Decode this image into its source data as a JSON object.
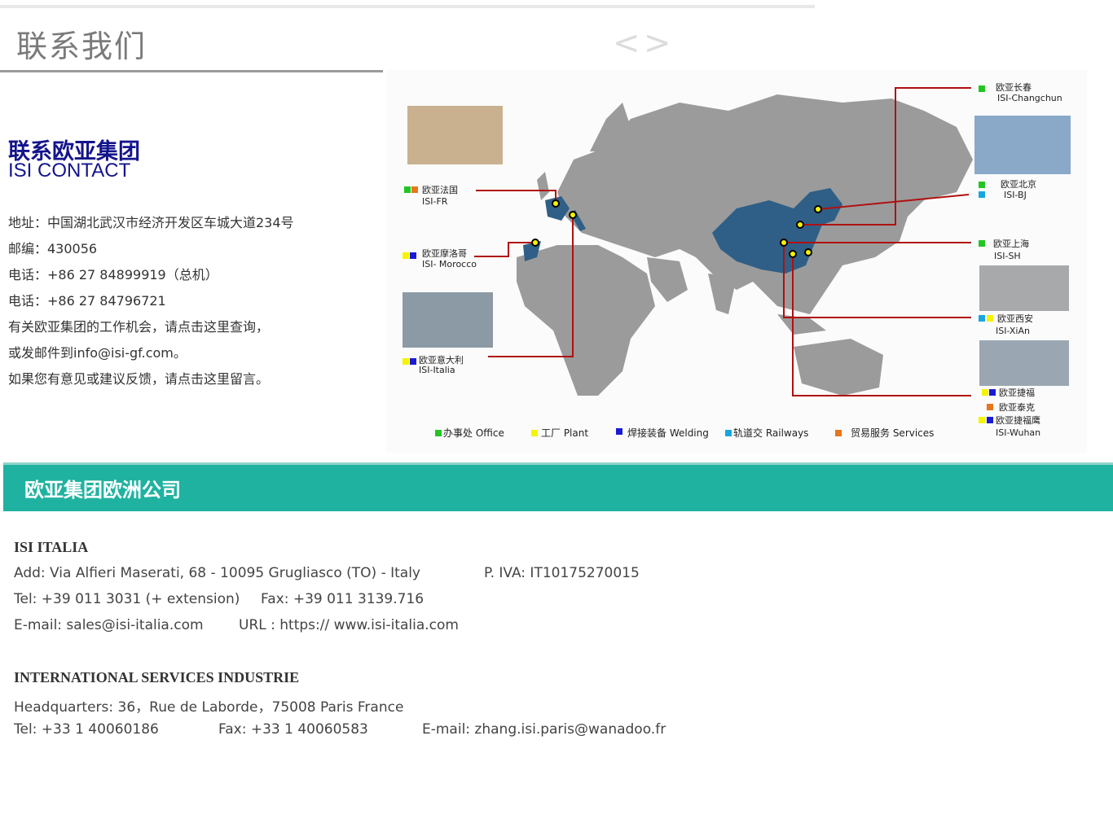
{
  "header": {
    "title": "联系我们",
    "prev_icon": "chevron-left-icon",
    "next_icon": "chevron-right-icon",
    "prev": "<",
    "next": ">"
  },
  "contact": {
    "title_cn": "联系欧亚集团",
    "title_en": "ISI CONTACT",
    "address": "地址：中国湖北武汉市经济开发区车城大道234号",
    "postcode": "邮编：430056",
    "phone1": "电话：+86 27 84899919（总机）",
    "phone2": "电话：+86 27 84796721",
    "jobs": "有关欧亚集团的工作机会，请点击这里查询，",
    "email": "或发邮件到info@isi-gf.com。",
    "feedback": "如果您有意见或建议反馈，请点击这里留言。"
  },
  "map": {
    "labels": {
      "changchun_cn": "欧亚长春",
      "changchun_en": "ISI-Changchun",
      "fr_cn": "欧亚法国",
      "fr_en": "ISI-FR",
      "bj_cn": "欧亚北京",
      "bj_en": "ISI-BJ",
      "morocco_cn": "欧亚摩洛哥",
      "morocco_en": "ISI- Morocco",
      "sh_cn": "欧亚上海",
      "sh_en": "ISI-SH",
      "xian_cn": "欧亚西安",
      "xian_en": "ISI-XiAn",
      "italia_cn": "欧亚意大利",
      "italia_en": "ISI-Italia",
      "wuhan1": "欧亚捷福",
      "wuhan2": "欧亚泰克",
      "wuhan3": "欧亚捷福鹰",
      "wuhan_en": "ISI-Wuhan"
    },
    "legend": {
      "office": "办事处 Office",
      "plant": "工厂 Plant",
      "welding": "焊接装备 Welding",
      "railways": "轨道交 Railways",
      "services": "贸易服务 Services"
    },
    "colors": {
      "office": "#22c622",
      "plant": "#f4f400",
      "welding": "#1a1ad6",
      "railways": "#18a6e0",
      "services": "#e8761a",
      "china": "#2f5f86",
      "land": "#9b9b9b",
      "arrow": "#b01010"
    }
  },
  "europe": {
    "bar_title": "欧亚集团欧洲公司",
    "italia": {
      "name": "ISI ITALIA",
      "address": "Add:  Via Alfieri Maserati, 68 - 10095 Grugliasco (TO) - Italy",
      "piva": "P. IVA:  IT10175270015",
      "tel": "Tel: +39 011 3031 (+ extension)",
      "fax": "Fax:  +39 011 3139.716",
      "email": "E-mail:  sales@isi-italia.com",
      "url": "URL : https:// www.isi-italia.com"
    },
    "isi": {
      "name": "INTERNATIONAL SERVICES INDUSTRIE",
      "hq": "Headquarters:  36，Rue de Laborde，75008 Paris France",
      "tel": "Tel:  +33 1 40060186",
      "fax": "Fax: +33 1 40060583",
      "email": "E-mail: zhang.isi.paris@wanadoo.fr"
    }
  },
  "colors": {
    "title_blue": "#14148c",
    "teal": "#20b2a0"
  }
}
